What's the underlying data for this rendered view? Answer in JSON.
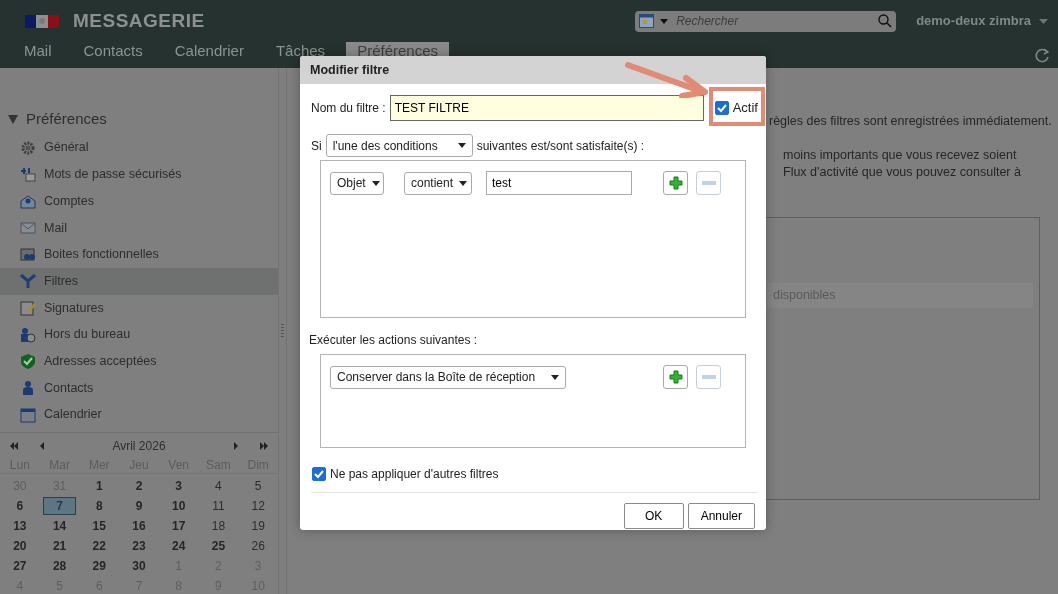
{
  "header": {
    "app_title": "MESSAGERIE",
    "search": {
      "placeholder": "Rechercher"
    },
    "user": "demo-deux zimbra"
  },
  "tabs": [
    {
      "label": "Mail",
      "selected": false
    },
    {
      "label": "Contacts",
      "selected": false
    },
    {
      "label": "Calendrier",
      "selected": false
    },
    {
      "label": "Tâches",
      "selected": false
    },
    {
      "label": "Préférences",
      "selected": true
    }
  ],
  "sidebar": {
    "title": "Préférences",
    "expanded": true,
    "items": [
      {
        "label": "Général",
        "selected": false
      },
      {
        "label": "Mots de passe sécurisés",
        "selected": false
      },
      {
        "label": "Comptes",
        "selected": false
      },
      {
        "label": "Mail",
        "selected": false
      },
      {
        "label": "Boites fonctionnelles",
        "selected": false
      },
      {
        "label": "Filtres",
        "selected": true
      },
      {
        "label": "Signatures",
        "selected": false
      },
      {
        "label": "Hors du bureau",
        "selected": false
      },
      {
        "label": "Adresses acceptées",
        "selected": false
      },
      {
        "label": "Contacts",
        "selected": false
      },
      {
        "label": "Calendrier",
        "selected": false
      }
    ]
  },
  "mini_calendar": {
    "title": "Avril 2026",
    "weekdays": [
      "Lun",
      "Mar",
      "Mer",
      "Jeu",
      "Ven",
      "Sam",
      "Dim"
    ],
    "weeks": [
      [
        {
          "day": "30",
          "kind": "other",
          "selected": false
        },
        {
          "day": "31",
          "kind": "other",
          "selected": false
        },
        {
          "day": "1",
          "kind": "bold",
          "selected": false
        },
        {
          "day": "2",
          "kind": "bold",
          "selected": false
        },
        {
          "day": "3",
          "kind": "bold",
          "selected": false
        },
        {
          "day": "4",
          "kind": "plain",
          "selected": false
        },
        {
          "day": "5",
          "kind": "plain",
          "selected": false
        }
      ],
      [
        {
          "day": "6",
          "kind": "bold",
          "selected": false
        },
        {
          "day": "7",
          "kind": "bold",
          "selected": true
        },
        {
          "day": "8",
          "kind": "bold",
          "selected": false
        },
        {
          "day": "9",
          "kind": "bold",
          "selected": false
        },
        {
          "day": "10",
          "kind": "bold",
          "selected": false
        },
        {
          "day": "11",
          "kind": "plain",
          "selected": false
        },
        {
          "day": "12",
          "kind": "plain",
          "selected": false
        }
      ],
      [
        {
          "day": "13",
          "kind": "bold",
          "selected": false
        },
        {
          "day": "14",
          "kind": "bold",
          "selected": false
        },
        {
          "day": "15",
          "kind": "bold",
          "selected": false
        },
        {
          "day": "16",
          "kind": "bold",
          "selected": false
        },
        {
          "day": "17",
          "kind": "bold",
          "selected": false
        },
        {
          "day": "18",
          "kind": "plain",
          "selected": false
        },
        {
          "day": "19",
          "kind": "plain",
          "selected": false
        }
      ],
      [
        {
          "day": "20",
          "kind": "bold",
          "selected": false
        },
        {
          "day": "21",
          "kind": "bold",
          "selected": false
        },
        {
          "day": "22",
          "kind": "bold",
          "selected": false
        },
        {
          "day": "23",
          "kind": "bold",
          "selected": false
        },
        {
          "day": "24",
          "kind": "bold",
          "selected": false
        },
        {
          "day": "25",
          "kind": "bold",
          "selected": false
        },
        {
          "day": "26",
          "kind": "plain",
          "selected": false
        }
      ],
      [
        {
          "day": "27",
          "kind": "bold",
          "selected": false
        },
        {
          "day": "28",
          "kind": "bold",
          "selected": false
        },
        {
          "day": "29",
          "kind": "bold",
          "selected": false
        },
        {
          "day": "30",
          "kind": "bold",
          "selected": false
        },
        {
          "day": "1",
          "kind": "other",
          "selected": false
        },
        {
          "day": "2",
          "kind": "other",
          "selected": false
        },
        {
          "day": "3",
          "kind": "other",
          "selected": false
        }
      ],
      [
        {
          "day": "4",
          "kind": "other",
          "selected": false
        },
        {
          "day": "5",
          "kind": "other",
          "selected": false
        },
        {
          "day": "6",
          "kind": "other",
          "selected": false
        },
        {
          "day": "7",
          "kind": "other",
          "selected": false
        },
        {
          "day": "8",
          "kind": "other",
          "selected": false
        },
        {
          "day": "9",
          "kind": "other",
          "selected": false
        },
        {
          "day": "10",
          "kind": "other",
          "selected": false
        }
      ]
    ]
  },
  "main": {
    "notice": "règles des filtres sont enregistrées immédiatement.",
    "info_lines": [
      "moins importants que vous recevez soient",
      "Flux d'activité que vous pouvez consulter à"
    ],
    "list_row": "disponibles"
  },
  "dialog": {
    "title": "Modifier filtre",
    "name_label": "Nom du filtre :",
    "name_value": "TEST FILTRE",
    "active": {
      "label": "Actif",
      "checked": true
    },
    "condition_prefix": "Si",
    "condition_mode": "l'une des conditions",
    "condition_suffix": "suivantes est/sont satisfaite(s) :",
    "conditions": [
      {
        "field": "Objet",
        "operator": "contient",
        "value": "test"
      }
    ],
    "actions_label": "Exécuter les actions suivantes :",
    "actions": [
      {
        "action": "Conserver dans la Boîte de réception"
      }
    ],
    "stop": {
      "label": "Ne pas appliquer d'autres filtres",
      "checked": true
    },
    "buttons": [
      "OK",
      "Annuler"
    ]
  }
}
